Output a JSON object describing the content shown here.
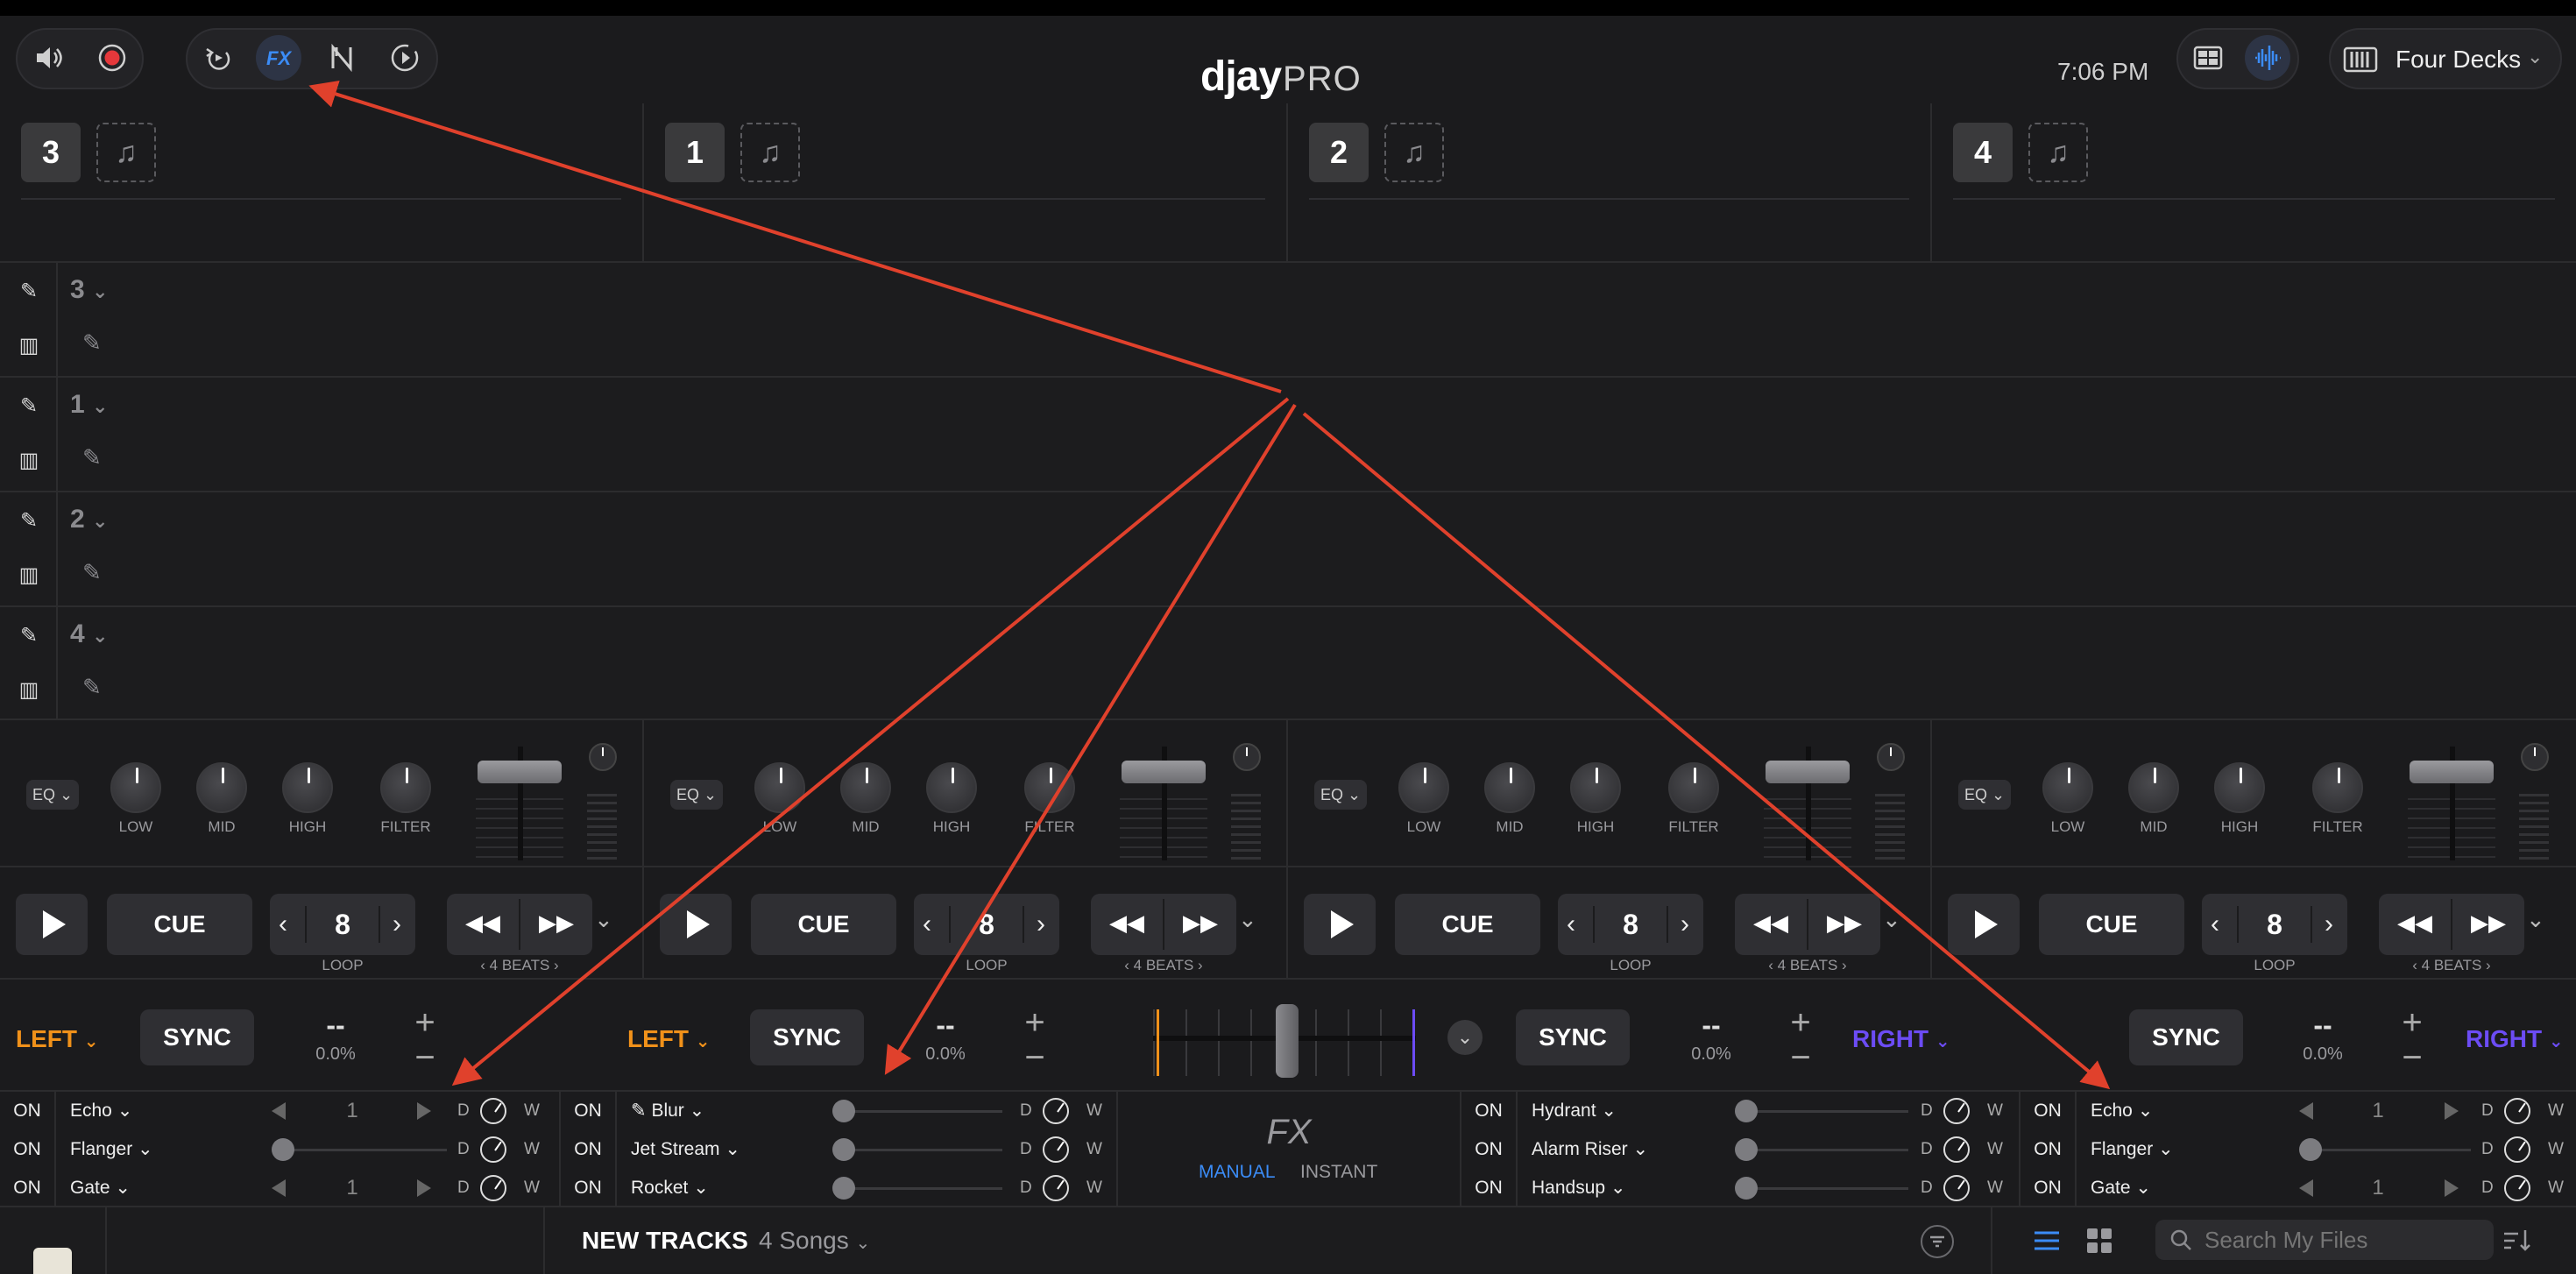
{
  "app": {
    "logo_main": "djay",
    "logo_sub": "PRO",
    "time": "7:06 PM",
    "layout_label": "Four Decks"
  },
  "deck_headers": [
    "3",
    "1",
    "2",
    "4"
  ],
  "lanes": [
    "3",
    "1",
    "2",
    "4"
  ],
  "mixer": {
    "eq_label": "EQ",
    "knob_labels": [
      "LOW",
      "MID",
      "HIGH",
      "FILTER"
    ]
  },
  "transport": {
    "cue_label": "CUE",
    "loop_value": "8",
    "loop_label": "LOOP",
    "beats_label": "‹  4 BEATS  ›"
  },
  "sync": {
    "sync_label": "SYNC",
    "pitch_dash": "--",
    "pitch_pct": "0.0%",
    "side_left": "LEFT",
    "side_right": "RIGHT",
    "left_color": "#f0911a",
    "right_color": "#6c4cf5"
  },
  "fx": {
    "on_label": "ON",
    "d_label": "D",
    "w_label": "W",
    "unit1": [
      {
        "name": "Echo",
        "value": "1"
      },
      {
        "name": "Flanger",
        "value": ""
      },
      {
        "name": "Gate",
        "value": "1"
      }
    ],
    "unit2": [
      {
        "name": "Blur"
      },
      {
        "name": "Jet Stream"
      },
      {
        "name": "Rocket"
      }
    ],
    "unit3": [
      {
        "name": "Hydrant"
      },
      {
        "name": "Alarm Riser"
      },
      {
        "name": "Handsup"
      }
    ],
    "unit4": [
      {
        "name": "Echo",
        "value": "1"
      },
      {
        "name": "Flanger",
        "value": ""
      },
      {
        "name": "Gate",
        "value": "1"
      }
    ],
    "center_title": "FX",
    "mode_manual": "MANUAL",
    "mode_instant": "INSTANT",
    "accent": "#3b8cf6"
  },
  "library": {
    "title": "NEW TRACKS",
    "count": "4 Songs",
    "search_placeholder": "Search My Files"
  },
  "annotation_color": "#e0412c"
}
